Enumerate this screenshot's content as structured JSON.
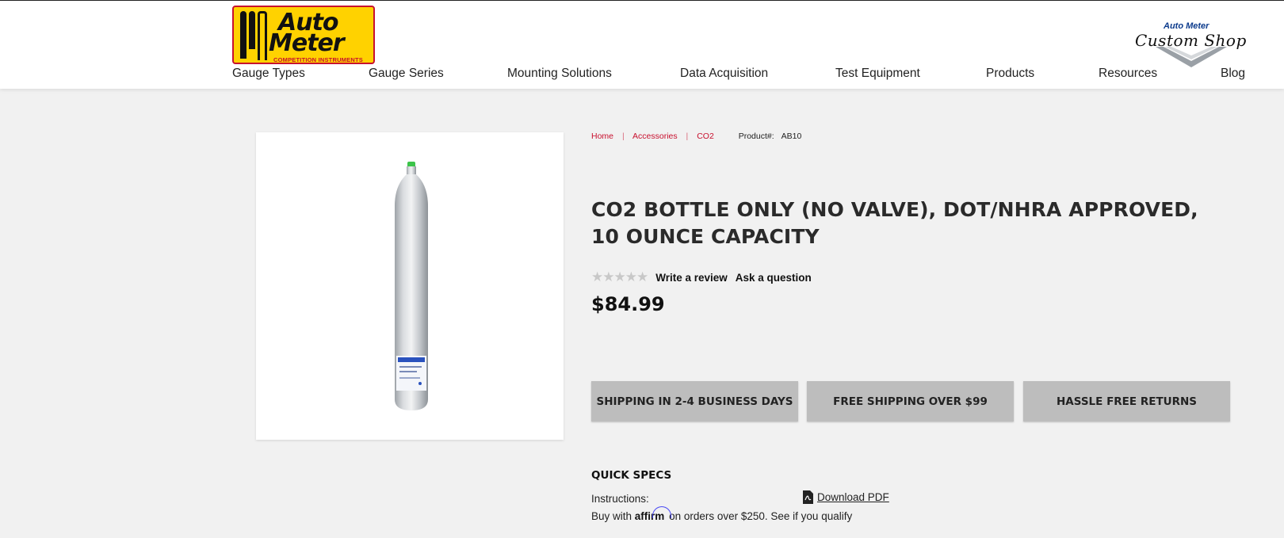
{
  "brand": {
    "logo_line1": "Auto",
    "logo_line2": "Meter",
    "logo_sub": "COMPETITION INSTRUMENTS",
    "custom_shop_top": "Auto Meter",
    "custom_shop_main": "Custom Shop"
  },
  "nav": {
    "items": [
      "Gauge Types",
      "Gauge Series",
      "Mounting Solutions",
      "Data Acquisition",
      "Test Equipment",
      "Products",
      "Resources",
      "Blog"
    ]
  },
  "breadcrumb": {
    "home": "Home",
    "accessories": "Accessories",
    "co2": "CO2",
    "sep": "|",
    "product_label": "Product#:",
    "product_number": "AB10"
  },
  "product": {
    "title": "CO2 BOTTLE ONLY (NO VALVE), DOT/NHRA APPROVED, 10 OUNCE CAPACITY",
    "rating": 0,
    "rating_max": 5,
    "write_review": "Write a review",
    "ask_question": "Ask a question",
    "price": "$84.99"
  },
  "badges": [
    "SHIPPING IN 2-4 BUSINESS DAYS",
    "FREE SHIPPING OVER $99",
    "HASSLE FREE RETURNS"
  ],
  "quick_specs": {
    "title": "QUICK SPECS",
    "instructions_label": "Instructions:",
    "download_label": "Download PDF"
  },
  "financing": {
    "prefix": "Buy with",
    "brand": "affirm",
    "suffix": "on orders over $250. See if you qualify"
  },
  "colors": {
    "accent": "#c8102e",
    "logo_yellow": "#ffd200",
    "badge_bg": "#bdbdbd",
    "page_bg": "#f1f1f1"
  }
}
